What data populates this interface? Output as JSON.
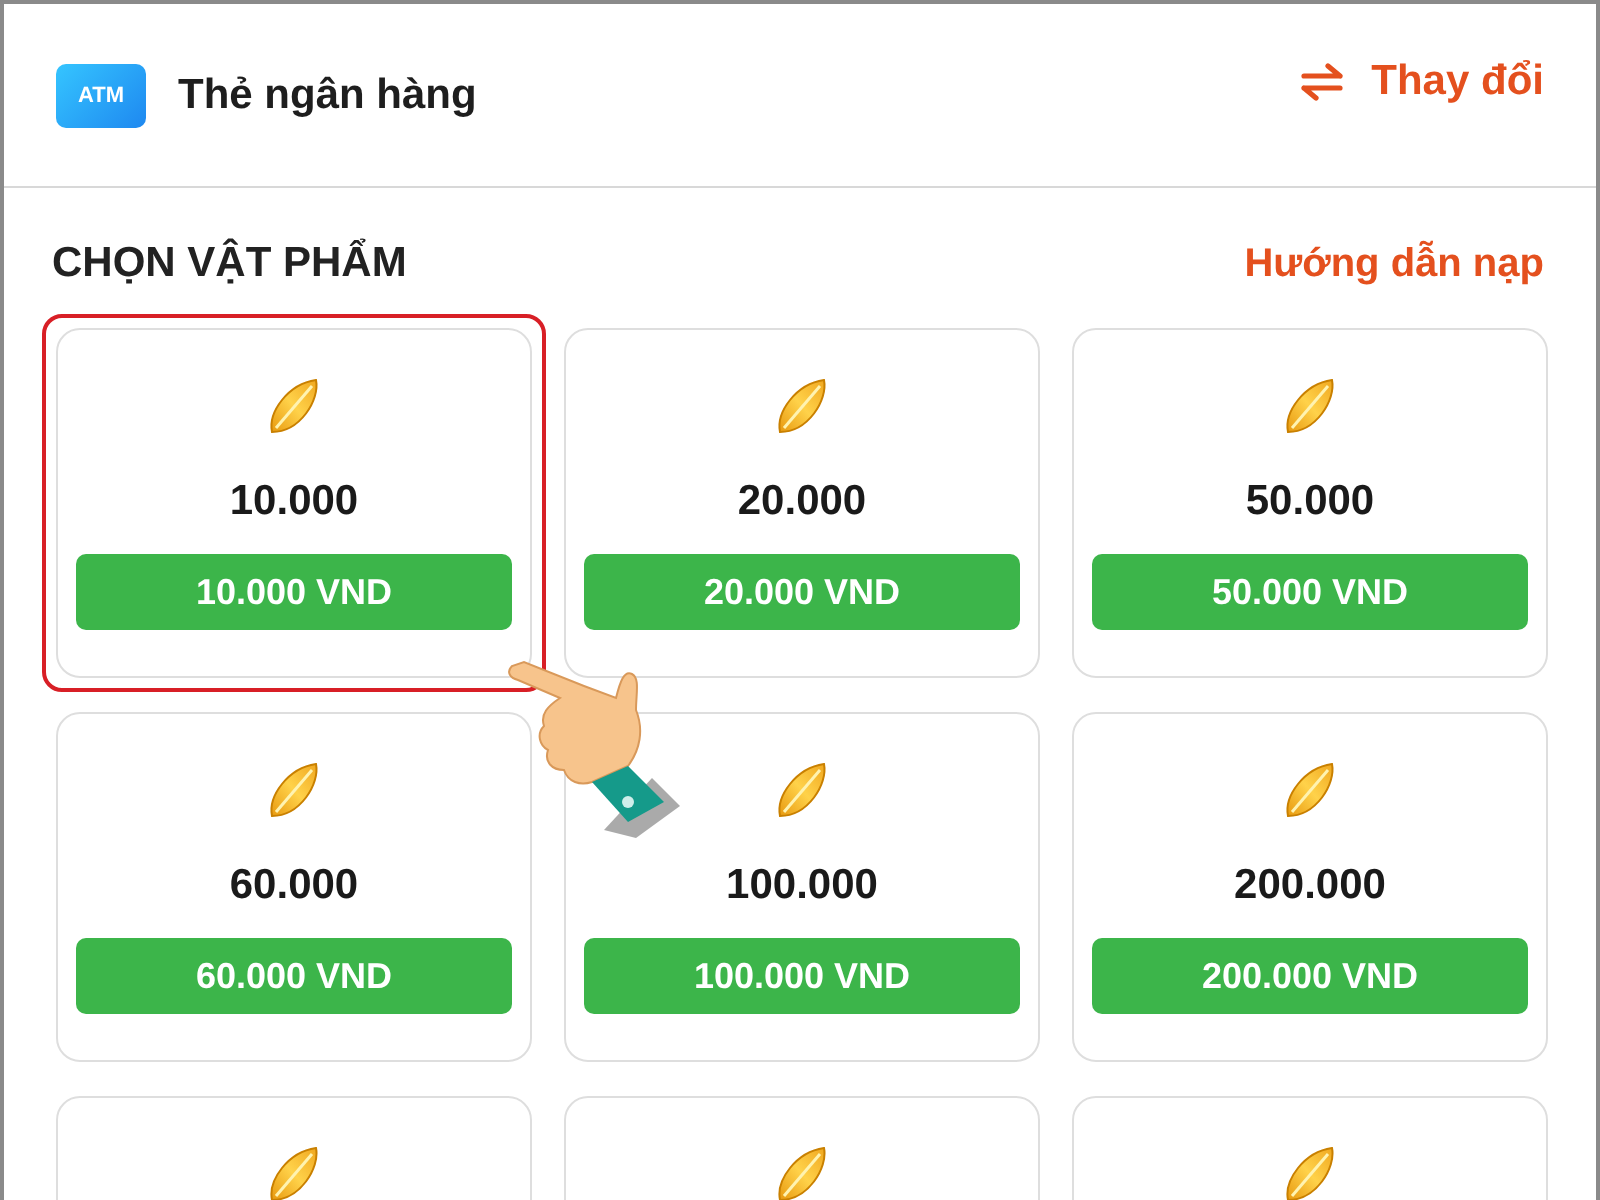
{
  "payment_method": {
    "badge": "ATM",
    "label": "Thẻ ngân hàng",
    "change_link": "Thay đổi"
  },
  "section": {
    "title": "CHỌN VẬT PHẨM",
    "guide_link": "Hướng dẫn nạp"
  },
  "items": [
    {
      "amount": "10.000",
      "price": "10.000 VND",
      "selected": true
    },
    {
      "amount": "20.000",
      "price": "20.000 VND",
      "selected": false
    },
    {
      "amount": "50.000",
      "price": "50.000 VND",
      "selected": false
    },
    {
      "amount": "60.000",
      "price": "60.000 VND",
      "selected": false
    },
    {
      "amount": "100.000",
      "price": "100.000 VND",
      "selected": false
    },
    {
      "amount": "200.000",
      "price": "200.000 VND",
      "selected": false
    },
    {
      "selected": false
    },
    {
      "selected": false
    },
    {
      "selected": false
    }
  ]
}
